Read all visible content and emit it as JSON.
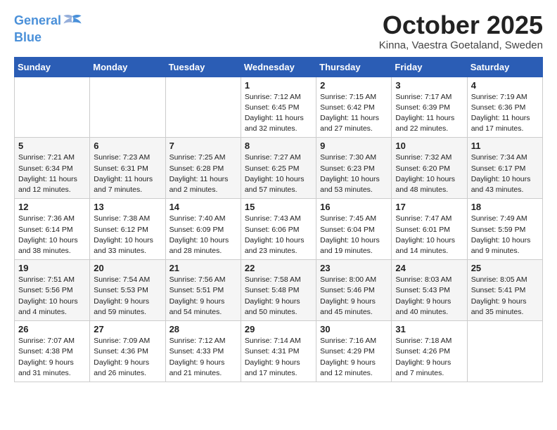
{
  "header": {
    "logo_line1": "General",
    "logo_line2": "Blue",
    "month": "October 2025",
    "location": "Kinna, Vaestra Goetaland, Sweden"
  },
  "weekdays": [
    "Sunday",
    "Monday",
    "Tuesday",
    "Wednesday",
    "Thursday",
    "Friday",
    "Saturday"
  ],
  "weeks": [
    [
      {
        "day": "",
        "detail": ""
      },
      {
        "day": "",
        "detail": ""
      },
      {
        "day": "",
        "detail": ""
      },
      {
        "day": "1",
        "detail": "Sunrise: 7:12 AM\nSunset: 6:45 PM\nDaylight: 11 hours\nand 32 minutes."
      },
      {
        "day": "2",
        "detail": "Sunrise: 7:15 AM\nSunset: 6:42 PM\nDaylight: 11 hours\nand 27 minutes."
      },
      {
        "day": "3",
        "detail": "Sunrise: 7:17 AM\nSunset: 6:39 PM\nDaylight: 11 hours\nand 22 minutes."
      },
      {
        "day": "4",
        "detail": "Sunrise: 7:19 AM\nSunset: 6:36 PM\nDaylight: 11 hours\nand 17 minutes."
      }
    ],
    [
      {
        "day": "5",
        "detail": "Sunrise: 7:21 AM\nSunset: 6:34 PM\nDaylight: 11 hours\nand 12 minutes."
      },
      {
        "day": "6",
        "detail": "Sunrise: 7:23 AM\nSunset: 6:31 PM\nDaylight: 11 hours\nand 7 minutes."
      },
      {
        "day": "7",
        "detail": "Sunrise: 7:25 AM\nSunset: 6:28 PM\nDaylight: 11 hours\nand 2 minutes."
      },
      {
        "day": "8",
        "detail": "Sunrise: 7:27 AM\nSunset: 6:25 PM\nDaylight: 10 hours\nand 57 minutes."
      },
      {
        "day": "9",
        "detail": "Sunrise: 7:30 AM\nSunset: 6:23 PM\nDaylight: 10 hours\nand 53 minutes."
      },
      {
        "day": "10",
        "detail": "Sunrise: 7:32 AM\nSunset: 6:20 PM\nDaylight: 10 hours\nand 48 minutes."
      },
      {
        "day": "11",
        "detail": "Sunrise: 7:34 AM\nSunset: 6:17 PM\nDaylight: 10 hours\nand 43 minutes."
      }
    ],
    [
      {
        "day": "12",
        "detail": "Sunrise: 7:36 AM\nSunset: 6:14 PM\nDaylight: 10 hours\nand 38 minutes."
      },
      {
        "day": "13",
        "detail": "Sunrise: 7:38 AM\nSunset: 6:12 PM\nDaylight: 10 hours\nand 33 minutes."
      },
      {
        "day": "14",
        "detail": "Sunrise: 7:40 AM\nSunset: 6:09 PM\nDaylight: 10 hours\nand 28 minutes."
      },
      {
        "day": "15",
        "detail": "Sunrise: 7:43 AM\nSunset: 6:06 PM\nDaylight: 10 hours\nand 23 minutes."
      },
      {
        "day": "16",
        "detail": "Sunrise: 7:45 AM\nSunset: 6:04 PM\nDaylight: 10 hours\nand 19 minutes."
      },
      {
        "day": "17",
        "detail": "Sunrise: 7:47 AM\nSunset: 6:01 PM\nDaylight: 10 hours\nand 14 minutes."
      },
      {
        "day": "18",
        "detail": "Sunrise: 7:49 AM\nSunset: 5:59 PM\nDaylight: 10 hours\nand 9 minutes."
      }
    ],
    [
      {
        "day": "19",
        "detail": "Sunrise: 7:51 AM\nSunset: 5:56 PM\nDaylight: 10 hours\nand 4 minutes."
      },
      {
        "day": "20",
        "detail": "Sunrise: 7:54 AM\nSunset: 5:53 PM\nDaylight: 9 hours\nand 59 minutes."
      },
      {
        "day": "21",
        "detail": "Sunrise: 7:56 AM\nSunset: 5:51 PM\nDaylight: 9 hours\nand 54 minutes."
      },
      {
        "day": "22",
        "detail": "Sunrise: 7:58 AM\nSunset: 5:48 PM\nDaylight: 9 hours\nand 50 minutes."
      },
      {
        "day": "23",
        "detail": "Sunrise: 8:00 AM\nSunset: 5:46 PM\nDaylight: 9 hours\nand 45 minutes."
      },
      {
        "day": "24",
        "detail": "Sunrise: 8:03 AM\nSunset: 5:43 PM\nDaylight: 9 hours\nand 40 minutes."
      },
      {
        "day": "25",
        "detail": "Sunrise: 8:05 AM\nSunset: 5:41 PM\nDaylight: 9 hours\nand 35 minutes."
      }
    ],
    [
      {
        "day": "26",
        "detail": "Sunrise: 7:07 AM\nSunset: 4:38 PM\nDaylight: 9 hours\nand 31 minutes."
      },
      {
        "day": "27",
        "detail": "Sunrise: 7:09 AM\nSunset: 4:36 PM\nDaylight: 9 hours\nand 26 minutes."
      },
      {
        "day": "28",
        "detail": "Sunrise: 7:12 AM\nSunset: 4:33 PM\nDaylight: 9 hours\nand 21 minutes."
      },
      {
        "day": "29",
        "detail": "Sunrise: 7:14 AM\nSunset: 4:31 PM\nDaylight: 9 hours\nand 17 minutes."
      },
      {
        "day": "30",
        "detail": "Sunrise: 7:16 AM\nSunset: 4:29 PM\nDaylight: 9 hours\nand 12 minutes."
      },
      {
        "day": "31",
        "detail": "Sunrise: 7:18 AM\nSunset: 4:26 PM\nDaylight: 9 hours\nand 7 minutes."
      },
      {
        "day": "",
        "detail": ""
      }
    ]
  ]
}
